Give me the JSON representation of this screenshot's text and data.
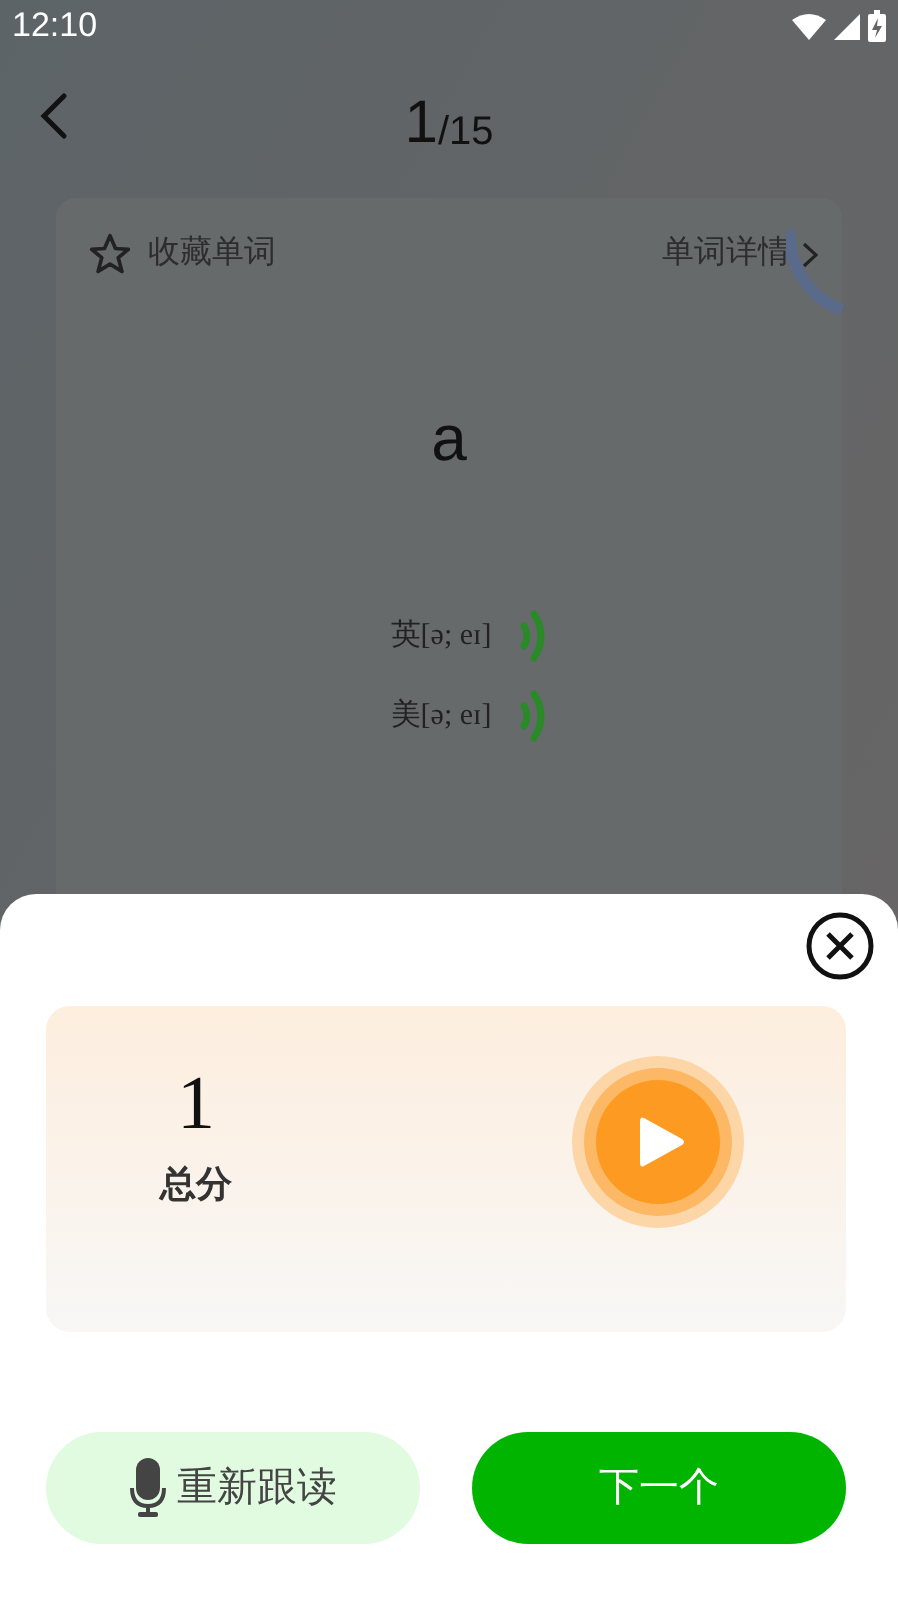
{
  "status_bar": {
    "time": "12:10"
  },
  "header": {
    "current": "1",
    "total": "/15"
  },
  "word_card": {
    "favorite_label": "收藏单词",
    "favorited": false,
    "details_link": "单词详情",
    "word": "a",
    "loading": true,
    "pronunciations": [
      {
        "label": "英[ə; eɪ]"
      },
      {
        "label": "美[ə; eɪ]"
      }
    ]
  },
  "result_sheet": {
    "score": "1",
    "score_label": "总分",
    "buttons": [
      {
        "kind": "secondary",
        "label": "重新跟读"
      },
      {
        "kind": "primary",
        "label": "下一个"
      }
    ]
  }
}
